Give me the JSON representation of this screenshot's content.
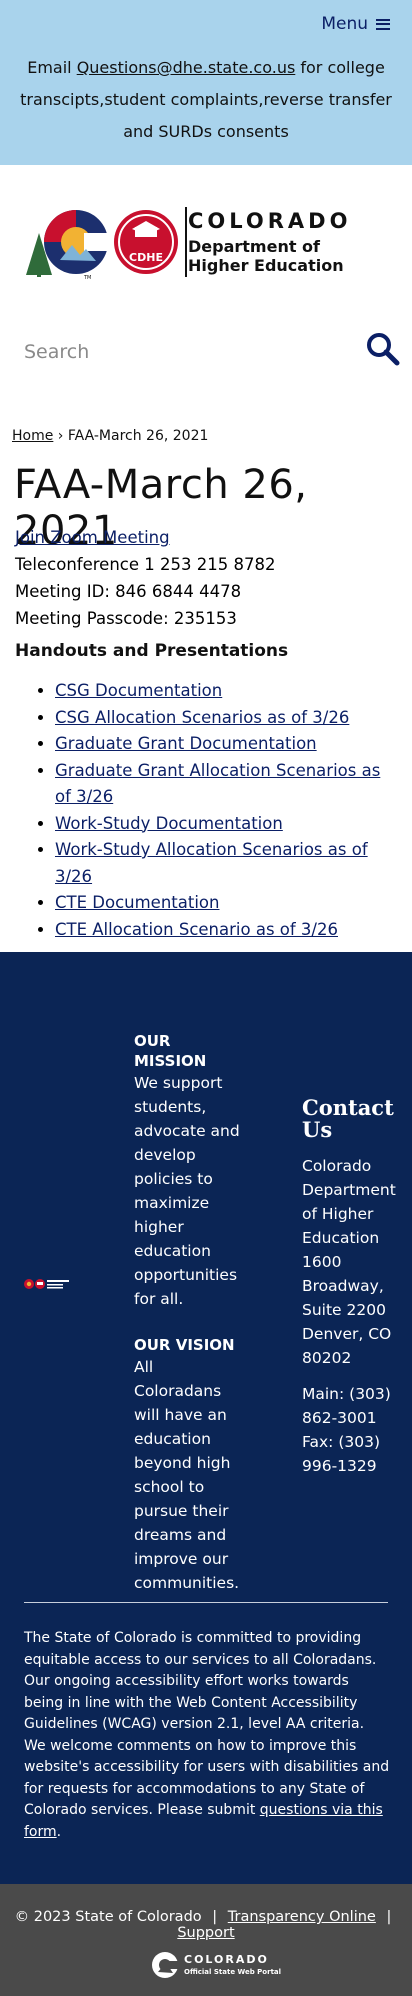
{
  "header": {
    "menu_label": "Menu",
    "notice_prefix": "Email ",
    "notice_email": "Questions@dhe.state.co.us",
    "notice_suffix": " for college transcipts,student complaints,reverse transfer and SURDs consents"
  },
  "logo": {
    "title": "COLORADO",
    "subtitle_line1": "Department of",
    "subtitle_line2": "Higher Education",
    "badge": "CDHE",
    "tm": "TM"
  },
  "search": {
    "placeholder": "Search"
  },
  "breadcrumb": {
    "home": "Home",
    "separator": "›",
    "current": "FAA-March 26, 2021"
  },
  "page": {
    "title": "FAA-March 26, 2021",
    "zoom_link": "Join Zoom Meeting",
    "teleconference": "Teleconference 1 253 215 8782",
    "meeting_id": "Meeting ID: 846 6844 4478",
    "passcode": "Meeting Passcode: 235153",
    "handouts_heading": "Handouts and Presentations",
    "handouts": [
      "CSG Documentation",
      "CSG Allocation Scenarios as of 3/26",
      "Graduate Grant Documentation",
      "Graduate Grant Allocation Scenarios as of 3/26",
      "Work-Study Documentation",
      "Work-Study Allocation Scenarios as of 3/26",
      "CTE Documentation",
      "CTE Allocation Scenario as of 3/26"
    ]
  },
  "footer": {
    "mission_heading": "OUR MISSION",
    "mission_text": "We support students, advocate and develop policies to maximize higher education opportunities for all.",
    "vision_heading": "OUR VISION",
    "vision_text": "All Coloradans will have an education beyond high school to pursue their dreams and improve our communities.",
    "contact_heading": "Contact Us",
    "contact_org": "Colorado Department of Higher Education",
    "contact_address": "1600 Broadway, Suite 2200 Denver, CO 80202",
    "contact_main": "Main: (303) 862-3001",
    "contact_fax": "Fax: (303) 996-1329",
    "accessibility_text": "The State of Colorado is committed to providing equitable access to our services to all Coloradans. Our ongoing accessibility effort works towards being in line with the Web Content Accessibility Guidelines (WCAG) version 2.1, level AA criteria. We welcome comments on how to improve this website's accessibility for users with disabilities and for requests for accommodations to any State of Colorado services. Please submit ",
    "accessibility_link": "questions via this form",
    "accessibility_end": "."
  },
  "bottom": {
    "copyright": "© 2023 State of Colorado",
    "separator": "|",
    "transparency": "Transparency Online",
    "support": "Support",
    "portal_title": "COLORADO",
    "portal_sub": "Official State Web Portal"
  },
  "colors": {
    "navy": "#0b1f66",
    "footer_bg": "#0b2555",
    "banner_bg": "#a9d3ec",
    "bottom_bg": "#4a4a4a"
  }
}
